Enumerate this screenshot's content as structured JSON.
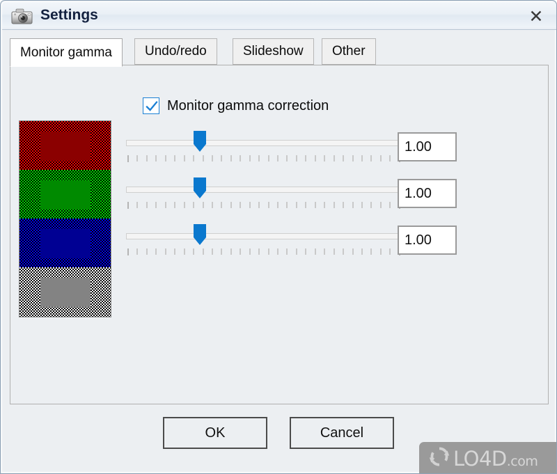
{
  "window": {
    "title": "Settings",
    "icon": "camera-icon",
    "close_label": "✕",
    "frame_color": "#8ea2b6",
    "titlebar_color": "#eaf0f6",
    "face_color": "#eceff2"
  },
  "tabs": [
    {
      "label": "Monitor gamma",
      "active": true
    },
    {
      "label": "Undo/redo",
      "active": false
    },
    {
      "label": "Slideshow",
      "active": false
    },
    {
      "label": "Other",
      "active": false
    }
  ],
  "monitor_gamma": {
    "checkbox": {
      "label": "Monitor gamma correction",
      "checked": true,
      "accent_color": "#1a7fd4"
    },
    "preview": {
      "name": "gamma-test-pattern",
      "bands": [
        {
          "channel": "red",
          "dither_color": "#ff0000",
          "solid_color": "#8b0000"
        },
        {
          "channel": "green",
          "dither_color": "#00dd00",
          "solid_color": "#008a00"
        },
        {
          "channel": "blue",
          "dither_color": "#0000ee",
          "solid_color": "#000093"
        },
        {
          "channel": "gray",
          "dither_color": "#ffffff",
          "solid_color": "#838383"
        }
      ]
    },
    "sliders": [
      {
        "channel": "red",
        "value": "1.00",
        "position_percent": 27,
        "min": "0.10",
        "max": "3.00",
        "ticks": 30
      },
      {
        "channel": "green",
        "value": "1.00",
        "position_percent": 27,
        "min": "0.10",
        "max": "3.00",
        "ticks": 30
      },
      {
        "channel": "blue",
        "value": "1.00",
        "position_percent": 27,
        "min": "0.10",
        "max": "3.00",
        "ticks": 30
      }
    ],
    "slider_accent_color": "#0a78ce"
  },
  "footer": {
    "ok_label": "OK",
    "cancel_label": "Cancel"
  },
  "watermark": {
    "brand": "LO4D",
    "suffix": ".com",
    "icon": "refresh-arrows-icon"
  }
}
